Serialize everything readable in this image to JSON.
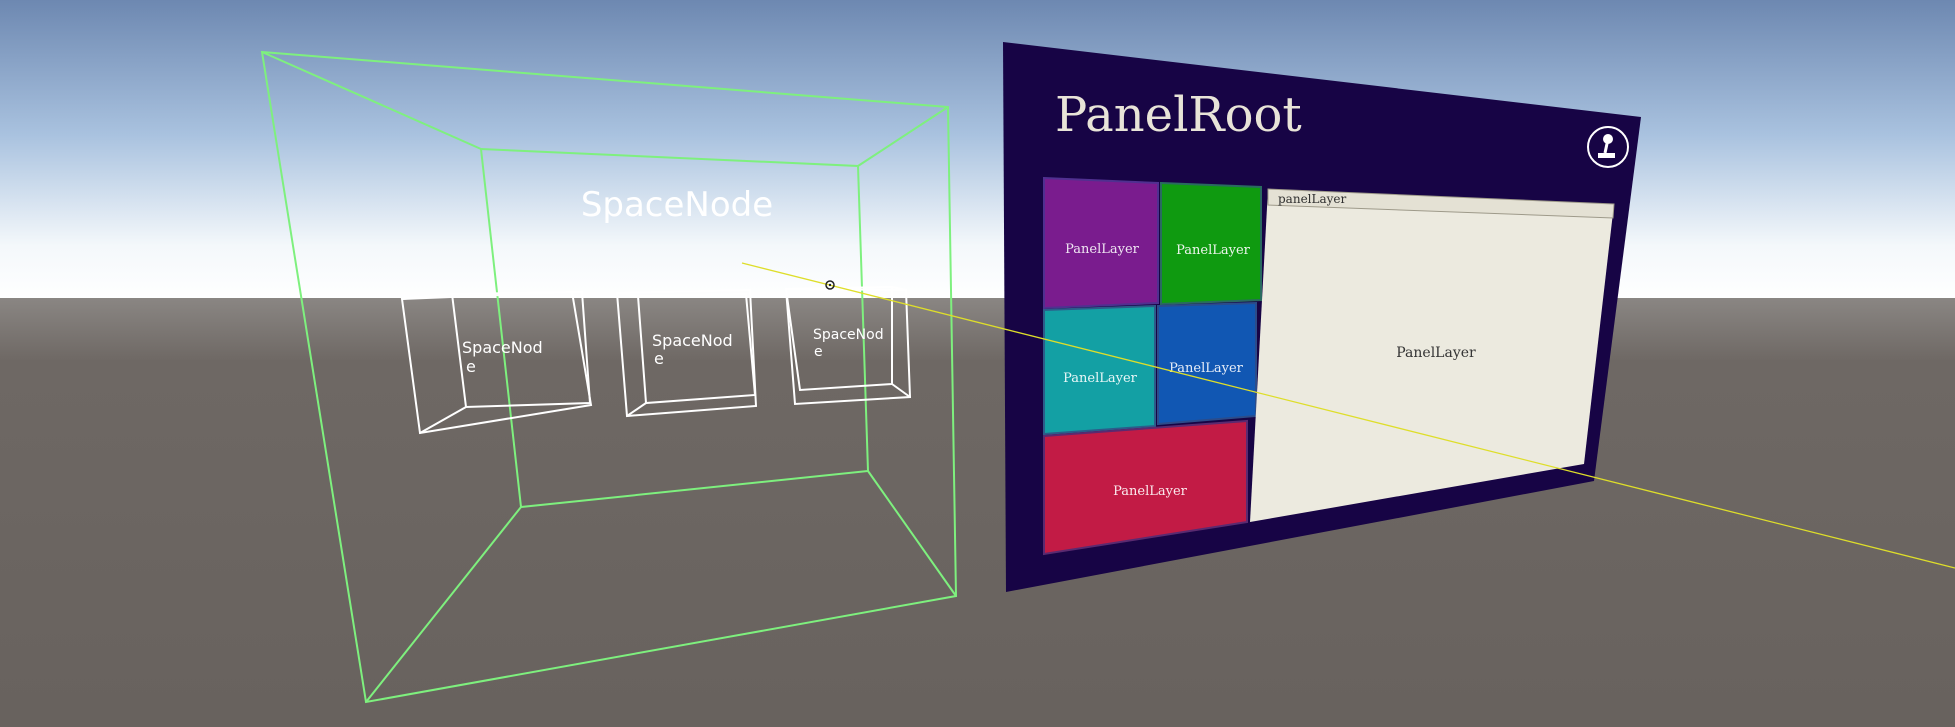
{
  "space": {
    "title": "SpaceNode",
    "nodes": [
      {
        "label_line1": "SpaceNod",
        "label_line2": "e"
      },
      {
        "label_line1": "SpaceNod",
        "label_line2": "e"
      },
      {
        "label_line1": "SpaceNod",
        "label_line2": "e"
      }
    ]
  },
  "panel": {
    "title": "PanelRoot",
    "header_icon": "joystick-icon",
    "tiles": [
      {
        "label": "PanelLayer",
        "color": "#7a1c8e"
      },
      {
        "label": "PanelLayer",
        "color": "#0f9a10"
      },
      {
        "label": "PanelLayer",
        "color": "#13a0a4"
      },
      {
        "label": "PanelLayer",
        "color": "#1157b3"
      },
      {
        "label": "PanelLayer",
        "color": "#c21b45"
      }
    ],
    "window": {
      "title": "panelLayer",
      "body_label": "PanelLayer"
    }
  },
  "colors": {
    "sky_top": "#6d88b1",
    "sky_horizon": "#ffffff",
    "ground": "#68625e",
    "panel_bg": "#170445",
    "wire_green": "#7ef07e",
    "wire_white": "#ffffff",
    "ray_yellow": "#dede2a"
  }
}
